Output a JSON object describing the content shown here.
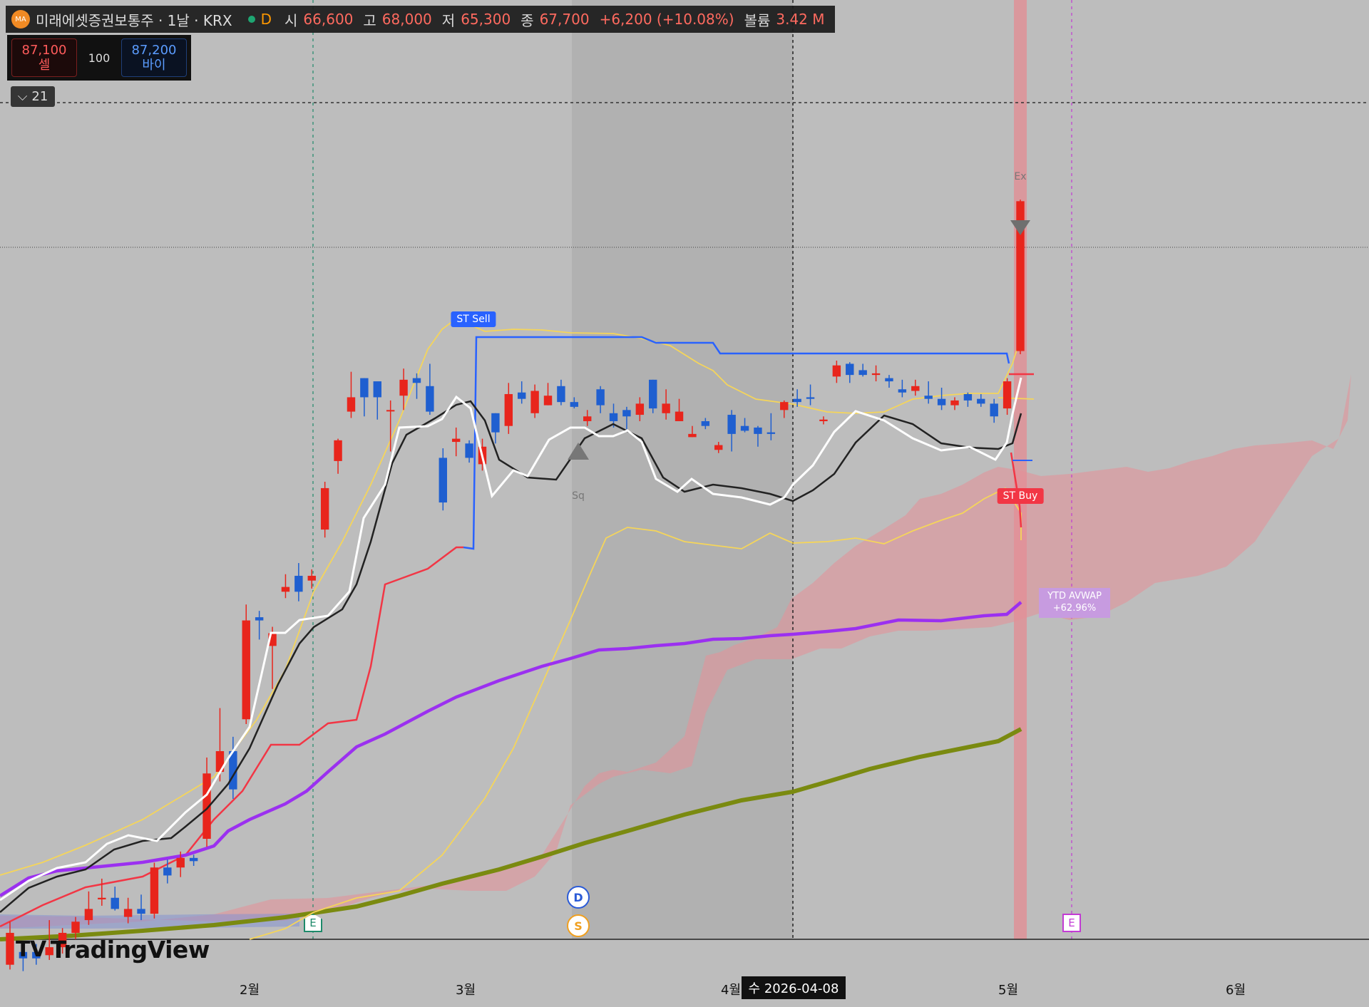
{
  "header": {
    "logo_text": "MA",
    "symbol": "미래에셋증권보통주 · 1날 · KRX",
    "timeframe_badge": "D",
    "open_label": "시",
    "open_value": "66,600",
    "high_label": "고",
    "high_value": "68,000",
    "low_label": "저",
    "low_value": "65,300",
    "close_label": "종",
    "close_value": "67,700",
    "change": "+6,200 (+10.08%)",
    "volume_label": "볼륨",
    "volume_value": "3.42 M"
  },
  "trade": {
    "sell_price": "87,100",
    "sell_label": "셀",
    "qty": "100",
    "buy_price": "87,200",
    "buy_label": "바이"
  },
  "indicator_toggle": {
    "icon": "chevron-down-icon",
    "count": "21"
  },
  "brand": "TradingView",
  "colors": {
    "up": "#e8251c",
    "down": "#1f5fd0",
    "supertrend_down": "#2962ff",
    "supertrend_up": "#f23645",
    "avwap": "#9b30f0",
    "long_ma": "#7a8a10",
    "bands": "#f5d55a",
    "cloud": "#e58f97"
  },
  "signals": {
    "st_sell": "ST Sell",
    "st_buy": "ST Buy",
    "squeeze": "Sq",
    "exit": "Ex"
  },
  "avwap_label": {
    "name": "YTD AVWAP",
    "value": "+62.96%"
  },
  "events": {
    "dividend": "D",
    "split": "S",
    "earnings_1": "E",
    "earnings_2": "E"
  },
  "crosshair_date": "수 2026-04-08",
  "chart_data": {
    "type": "candlestick",
    "x_axis_labels": [
      "2월",
      "3월",
      "4월",
      "5월",
      "6월"
    ],
    "price_scale": "hidden",
    "candles": [
      {
        "o": 37200,
        "h": 37900,
        "l": 34900,
        "c": 35200,
        "d": "up"
      },
      {
        "o": 35600,
        "h": 36200,
        "l": 34800,
        "c": 36000,
        "d": "down"
      },
      {
        "o": 36000,
        "h": 36500,
        "l": 35200,
        "c": 35600,
        "d": "down"
      },
      {
        "o": 35800,
        "h": 38000,
        "l": 35500,
        "c": 36300,
        "d": "up"
      },
      {
        "o": 36300,
        "h": 37500,
        "l": 35900,
        "c": 37200,
        "d": "up"
      },
      {
        "o": 37200,
        "h": 38200,
        "l": 36800,
        "c": 37900,
        "d": "up"
      },
      {
        "o": 38000,
        "h": 39800,
        "l": 37700,
        "c": 38700,
        "d": "up"
      },
      {
        "o": 39300,
        "h": 40600,
        "l": 38900,
        "c": 39400,
        "d": "up"
      },
      {
        "o": 39400,
        "h": 40100,
        "l": 38600,
        "c": 38700,
        "d": "down"
      },
      {
        "o": 38700,
        "h": 39400,
        "l": 37800,
        "c": 38200,
        "d": "up"
      },
      {
        "o": 38700,
        "h": 39600,
        "l": 38000,
        "c": 38400,
        "d": "down"
      },
      {
        "o": 38400,
        "h": 41600,
        "l": 38100,
        "c": 41300,
        "d": "up"
      },
      {
        "o": 41300,
        "h": 41800,
        "l": 40300,
        "c": 40800,
        "d": "down"
      },
      {
        "o": 41300,
        "h": 42300,
        "l": 40700,
        "c": 41900,
        "d": "up"
      },
      {
        "o": 41900,
        "h": 42100,
        "l": 41400,
        "c": 41700,
        "d": "down"
      },
      {
        "o": 43100,
        "h": 48200,
        "l": 42600,
        "c": 47200,
        "d": "up"
      },
      {
        "o": 47300,
        "h": 51300,
        "l": 46700,
        "c": 48600,
        "d": "up"
      },
      {
        "o": 48600,
        "h": 49500,
        "l": 45600,
        "c": 46200,
        "d": "down"
      },
      {
        "o": 50600,
        "h": 57800,
        "l": 50300,
        "c": 56800,
        "d": "up"
      },
      {
        "o": 56800,
        "h": 57400,
        "l": 55600,
        "c": 57000,
        "d": "down"
      },
      {
        "o": 56000,
        "h": 56400,
        "l": 52500,
        "c": 55200,
        "d": "up"
      },
      {
        "o": 58600,
        "h": 59700,
        "l": 58200,
        "c": 58900,
        "d": "up"
      },
      {
        "o": 59600,
        "h": 60400,
        "l": 58000,
        "c": 58600,
        "d": "down"
      },
      {
        "o": 59300,
        "h": 60000,
        "l": 58800,
        "c": 59600,
        "d": "up"
      },
      {
        "o": 62500,
        "h": 65500,
        "l": 62000,
        "c": 65100,
        "d": "up"
      },
      {
        "o": 66800,
        "h": 68200,
        "l": 66000,
        "c": 68100,
        "d": "up"
      },
      {
        "o": 69900,
        "h": 72400,
        "l": 69500,
        "c": 70800,
        "d": "up"
      },
      {
        "o": 70800,
        "h": 72000,
        "l": 69600,
        "c": 72000,
        "d": "down"
      },
      {
        "o": 70800,
        "h": 71500,
        "l": 69400,
        "c": 71800,
        "d": "down"
      },
      {
        "o": 70000,
        "h": 70600,
        "l": 67400,
        "c": 70000,
        "d": "up"
      },
      {
        "o": 70900,
        "h": 72600,
        "l": 70000,
        "c": 71900,
        "d": "up"
      },
      {
        "o": 72000,
        "h": 72300,
        "l": 70700,
        "c": 71700,
        "d": "down"
      },
      {
        "o": 71500,
        "h": 72900,
        "l": 69700,
        "c": 69900,
        "d": "down"
      },
      {
        "o": 67000,
        "h": 67600,
        "l": 63700,
        "c": 64200,
        "d": "down"
      },
      {
        "o": 68000,
        "h": 68900,
        "l": 67100,
        "c": 68200,
        "d": "up"
      },
      {
        "o": 67000,
        "h": 68100,
        "l": 66700,
        "c": 67900,
        "d": "down"
      },
      {
        "o": 67700,
        "h": 68200,
        "l": 66200,
        "c": 66600,
        "d": "up"
      },
      {
        "o": 68600,
        "h": 69800,
        "l": 67900,
        "c": 69800,
        "d": "down"
      },
      {
        "o": 69000,
        "h": 71700,
        "l": 68500,
        "c": 71000,
        "d": "up"
      },
      {
        "o": 71100,
        "h": 71800,
        "l": 70400,
        "c": 70700,
        "d": "down"
      },
      {
        "o": 69800,
        "h": 71600,
        "l": 69500,
        "c": 71200,
        "d": "up"
      },
      {
        "o": 70900,
        "h": 71700,
        "l": 70300,
        "c": 70300,
        "d": "up"
      },
      {
        "o": 71500,
        "h": 71900,
        "l": 70300,
        "c": 70500,
        "d": "down"
      },
      {
        "o": 70500,
        "h": 70800,
        "l": 70100,
        "c": 70200,
        "d": "down"
      },
      {
        "o": 69600,
        "h": 70000,
        "l": 69000,
        "c": 69300,
        "d": "up"
      },
      {
        "o": 70300,
        "h": 71500,
        "l": 69800,
        "c": 71300,
        "d": "down"
      },
      {
        "o": 69800,
        "h": 70400,
        "l": 68900,
        "c": 69300,
        "d": "down"
      },
      {
        "o": 69600,
        "h": 70200,
        "l": 68800,
        "c": 70000,
        "d": "down"
      },
      {
        "o": 69700,
        "h": 70800,
        "l": 69300,
        "c": 70400,
        "d": "up"
      },
      {
        "o": 70100,
        "h": 71900,
        "l": 69800,
        "c": 71900,
        "d": "down"
      },
      {
        "o": 69800,
        "h": 71300,
        "l": 69400,
        "c": 70400,
        "d": "up"
      },
      {
        "o": 69900,
        "h": 70700,
        "l": 69300,
        "c": 69300,
        "d": "up"
      },
      {
        "o": 68500,
        "h": 69000,
        "l": 68300,
        "c": 68300,
        "d": "up"
      },
      {
        "o": 69300,
        "h": 69500,
        "l": 68800,
        "c": 69000,
        "d": "down"
      },
      {
        "o": 67800,
        "h": 68000,
        "l": 67300,
        "c": 67500,
        "d": "up"
      },
      {
        "o": 68500,
        "h": 70000,
        "l": 67400,
        "c": 69700,
        "d": "down"
      },
      {
        "o": 69000,
        "h": 69500,
        "l": 68600,
        "c": 68700,
        "d": "down"
      },
      {
        "o": 68500,
        "h": 69000,
        "l": 67700,
        "c": 68900,
        "d": "down"
      },
      {
        "o": 68600,
        "h": 69800,
        "l": 68100,
        "c": 68500,
        "d": "down"
      },
      {
        "o": 70000,
        "h": 70600,
        "l": 69500,
        "c": 70500,
        "d": "up"
      },
      {
        "o": 70700,
        "h": 71300,
        "l": 70200,
        "c": 70500,
        "d": "down"
      },
      {
        "o": 70800,
        "h": 71600,
        "l": 70300,
        "c": 70700,
        "d": "down"
      },
      {
        "o": 69300,
        "h": 69600,
        "l": 69100,
        "c": 69400,
        "d": "up"
      },
      {
        "o": 72100,
        "h": 73100,
        "l": 71700,
        "c": 72800,
        "d": "up"
      },
      {
        "o": 72200,
        "h": 73000,
        "l": 71700,
        "c": 72900,
        "d": "down"
      },
      {
        "o": 72500,
        "h": 72900,
        "l": 72100,
        "c": 72200,
        "d": "down"
      },
      {
        "o": 72300,
        "h": 72800,
        "l": 71800,
        "c": 72200,
        "d": "up"
      },
      {
        "o": 72000,
        "h": 72200,
        "l": 71400,
        "c": 71800,
        "d": "down"
      },
      {
        "o": 71300,
        "h": 71900,
        "l": 70800,
        "c": 71100,
        "d": "down"
      },
      {
        "o": 71500,
        "h": 71900,
        "l": 70900,
        "c": 71200,
        "d": "up"
      },
      {
        "o": 70900,
        "h": 71800,
        "l": 70400,
        "c": 70700,
        "d": "down"
      },
      {
        "o": 70700,
        "h": 71400,
        "l": 70000,
        "c": 70300,
        "d": "down"
      },
      {
        "o": 70300,
        "h": 70800,
        "l": 70000,
        "c": 70600,
        "d": "up"
      },
      {
        "o": 71000,
        "h": 71100,
        "l": 70200,
        "c": 70600,
        "d": "down"
      },
      {
        "o": 70700,
        "h": 71000,
        "l": 70200,
        "c": 70400,
        "d": "down"
      },
      {
        "o": 69600,
        "h": 70700,
        "l": 69200,
        "c": 70400,
        "d": "down"
      },
      {
        "o": 70100,
        "h": 72000,
        "l": 69700,
        "c": 71800,
        "d": "up"
      },
      {
        "o": 73700,
        "h": 83200,
        "l": 73500,
        "c": 83100,
        "d": "up"
      }
    ],
    "series": [
      {
        "name": "YTD AVWAP",
        "color": "#9b30f0"
      }
    ],
    "grid": false
  }
}
